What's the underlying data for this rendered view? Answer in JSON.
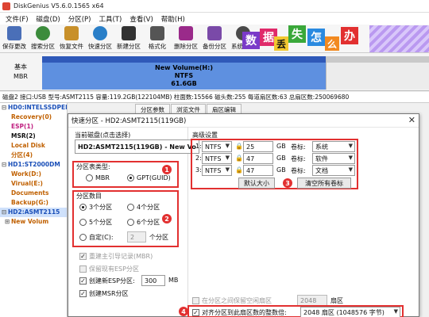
{
  "window": {
    "title": "DiskGenius V5.6.0.1565 x64"
  },
  "menu": [
    "文件(F)",
    "磁盘(D)",
    "分区(P)",
    "工具(T)",
    "查看(V)",
    "帮助(H)"
  ],
  "toolbar": [
    {
      "label": "保存更改",
      "icon": "save-icon",
      "color": "#4a6fb8"
    },
    {
      "label": "搜索分区",
      "icon": "search-partition-icon",
      "color": "#3c8c3c"
    },
    {
      "label": "恢复文件",
      "icon": "recover-file-icon",
      "color": "#c8902a"
    },
    {
      "label": "快速分区",
      "icon": "quick-partition-icon",
      "color": "#2a7fc8"
    },
    {
      "label": "新建分区",
      "icon": "new-partition-icon",
      "color": "#333333"
    },
    {
      "label": "格式化",
      "icon": "format-icon",
      "color": "#555555"
    },
    {
      "label": "删除分区",
      "icon": "delete-partition-icon",
      "color": "#9a2a8a"
    },
    {
      "label": "备份分区",
      "icon": "backup-partition-icon",
      "color": "#7a4aa8"
    },
    {
      "label": "系统迁移",
      "icon": "migrate-system-icon",
      "color": "#4a4a4a"
    }
  ],
  "ad": {
    "chars": [
      "数",
      "据",
      "丢",
      "失",
      "怎",
      "么",
      "办"
    ]
  },
  "diskbar": {
    "side_line1": "基本",
    "side_line2": "MBR",
    "volume_name": "New Volume(H:)",
    "volume_fs": "NTFS",
    "volume_size": "61.6GB"
  },
  "diskinfo": "磁盘2 接口:USB  型号:ASMT2115  容量:119.2GB(122104MB)  柱面数:15566  磁头数:255  每道扇区数:63  总扇区数:250069680",
  "tree": [
    {
      "label": "HD0:INTELSSDPEKKW256G8(238GB)",
      "style": "bold",
      "exp": "⊟"
    },
    {
      "label": "Recovery(0)",
      "style": "orange",
      "exp": ""
    },
    {
      "label": "ESP(1)",
      "style": "pink",
      "exp": ""
    },
    {
      "label": "MSR(2)",
      "style": "",
      "exp": ""
    },
    {
      "label": "Local Disk",
      "style": "orange",
      "exp": ""
    },
    {
      "label": "分区(4)",
      "style": "orange",
      "exp": ""
    },
    {
      "label": "HD1:ST2000DM",
      "style": "bold",
      "exp": "⊟"
    },
    {
      "label": "Work(D:)",
      "style": "orange",
      "exp": ""
    },
    {
      "label": "Virual(E:)",
      "style": "orange",
      "exp": ""
    },
    {
      "label": "Documents",
      "style": "orange",
      "exp": ""
    },
    {
      "label": "Backup(G:)",
      "style": "orange",
      "exp": ""
    },
    {
      "label": "HD2:ASMT2115",
      "style": "bold sel",
      "exp": "⊟"
    },
    {
      "label": "New Volum",
      "style": "orange",
      "exp": "⊞"
    }
  ],
  "right_tabs": [
    "分区参数",
    "浏览文件",
    "扇区编辑"
  ],
  "dialog": {
    "title": "快速分区 - HD2:ASMT2115(119GB)",
    "current_disk_label": "当前磁盘(点击选择)",
    "current_disk_value": "HD2:ASMT2115(119GB) - New Vo",
    "partition_table_label": "分区表类型:",
    "mbr_label": "MBR",
    "gpt_label": "GPT(GUID)",
    "partition_count_label": "分区数目",
    "count_options": [
      "3个分区",
      "4个分区",
      "5个分区",
      "6个分区"
    ],
    "custom_label": "自定(C):",
    "custom_value": "2",
    "custom_unit": "个分区",
    "rebuild_mbr": "重建主引导记录(MBR)",
    "keep_esp": "保留现有ESP分区",
    "create_esp": "创建新ESP分区:",
    "esp_size": "300",
    "esp_unit": "MB",
    "create_msr": "创建MSR分区",
    "advanced_label": "高级设置",
    "rows": [
      {
        "num": "1:",
        "fs": "NTFS",
        "size": "25",
        "unit": "GB",
        "vol_label": "卷标:",
        "vol": "系统"
      },
      {
        "num": "2:",
        "fs": "NTFS",
        "size": "47",
        "unit": "GB",
        "vol_label": "卷标:",
        "vol": "软件"
      },
      {
        "num": "3:",
        "fs": "NTFS",
        "size": "47",
        "unit": "GB",
        "vol_label": "卷标:",
        "vol": "文档"
      }
    ],
    "default_size_btn": "默认大小",
    "clear_labels_btn": "清空所有卷标",
    "free_space_chk": "在分区之间保留空闲扇区",
    "free_space_value": "2048",
    "free_space_unit": "扇区",
    "align_chk": "对齐分区到此扇区数的整数倍:",
    "align_value": "2048 扇区 (1048576 字节)",
    "markers": [
      "1",
      "2",
      "3",
      "4"
    ]
  },
  "colors": {
    "accent_red": "#e23030",
    "volume_blue": "#5e90e0"
  }
}
